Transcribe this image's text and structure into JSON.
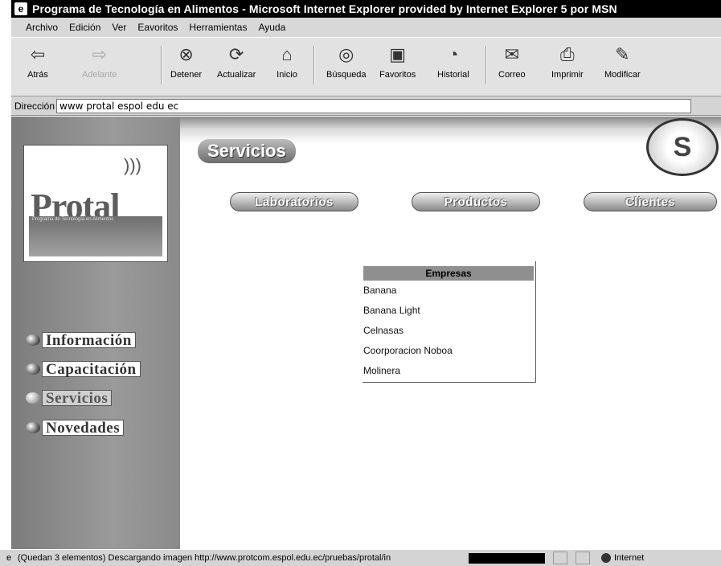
{
  "window": {
    "title": "Programa de Tecnología en Alimentos - Microsoft Internet Explorer provided by Internet Explorer 5 por MSN"
  },
  "menu": [
    "Archivo",
    "Edición",
    "Ver",
    "Eavoritos",
    "Herramientas",
    "Ayuda"
  ],
  "toolbar": {
    "back": "Atrás",
    "forward": "Adelante",
    "stop": "Detener",
    "refresh": "Actualizar",
    "home": "Inicio",
    "search": "Búsqueda",
    "favorites": "Favoritos",
    "history": "Historial",
    "mail": "Correo",
    "print": "Imprimir",
    "edit": "Modificar"
  },
  "address": {
    "label": "Dirección",
    "value": "www protal espol edu ec"
  },
  "sidebar": {
    "logo_text": "Protal",
    "logo_subtitle": "Programa de Tecnología en Alimentos",
    "nav": [
      "Información",
      "Capacitación",
      "Servicios",
      "Novedades"
    ],
    "active_index": 2
  },
  "main": {
    "section_title": "Servicios",
    "tabs": [
      "Laboratorios",
      "Productos",
      "Clientes"
    ],
    "dropdown": {
      "header": "Empresas",
      "items": [
        "Banana",
        "Banana Light",
        "Celnasas",
        "Coorporacion Noboa",
        "Molinera"
      ]
    }
  },
  "status": {
    "text": "(Quedan 3 elementos) Descargando imagen http://www.protcom.espol.edu.ec/pruebas/protal/in",
    "zone": "Internet"
  },
  "colors": {
    "titlebar": "#000000",
    "sidebar": "#8a8a8a",
    "dropdown_header": "#8f8f8f"
  }
}
